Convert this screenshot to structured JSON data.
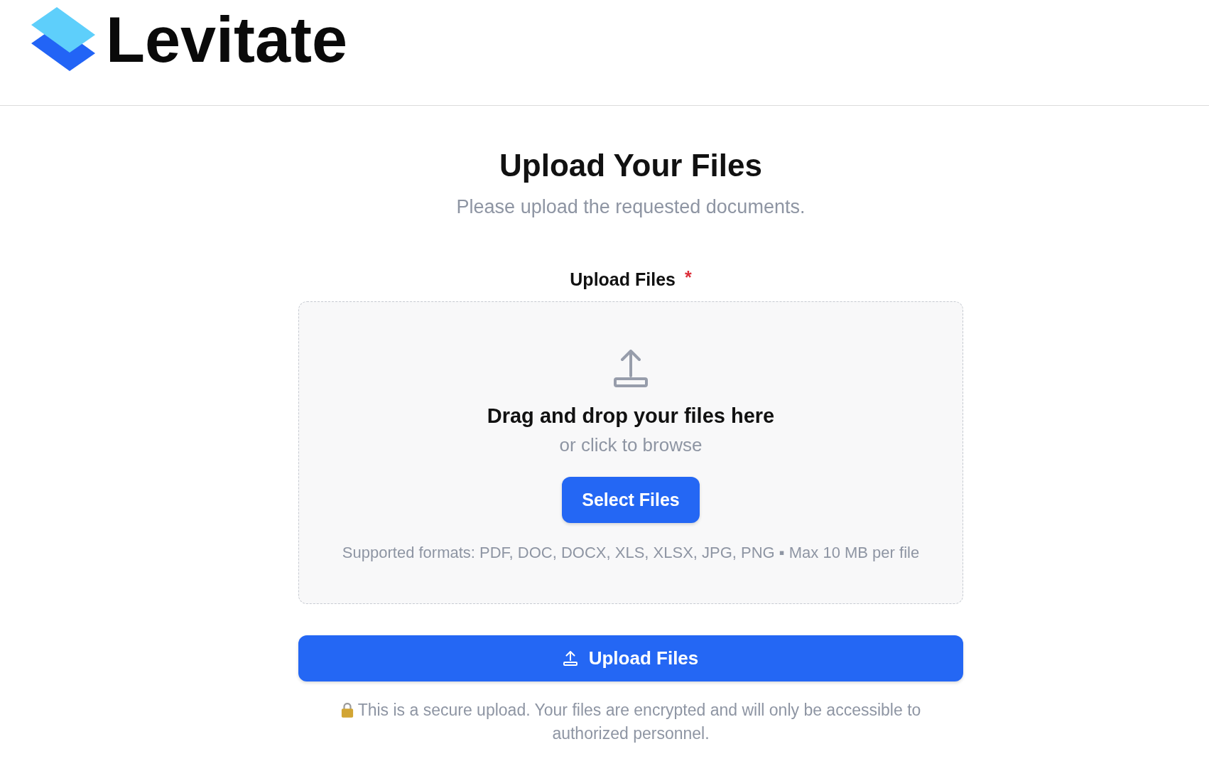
{
  "header": {
    "logo": {
      "wordmark": "Levitate"
    }
  },
  "page": {
    "title": "Upload Your Files",
    "subtitle": "Please upload the requested documents."
  },
  "upload_field": {
    "label": "Upload Files",
    "required": true,
    "required_mark": "*",
    "dropzone": {
      "heading": "Drag and drop your files here",
      "hint": "or click to browse",
      "button": "Select Files",
      "formats_note": "Supported formats: PDF, DOC, DOCX, XLS, XLSX, JPG, PNG ▪ Max 10 MB per file"
    }
  },
  "submit_button": {
    "label": "Upload Files"
  },
  "security_note": "This is a secure upload. Your files are encrypted and will only be accessible to authorized personnel."
}
